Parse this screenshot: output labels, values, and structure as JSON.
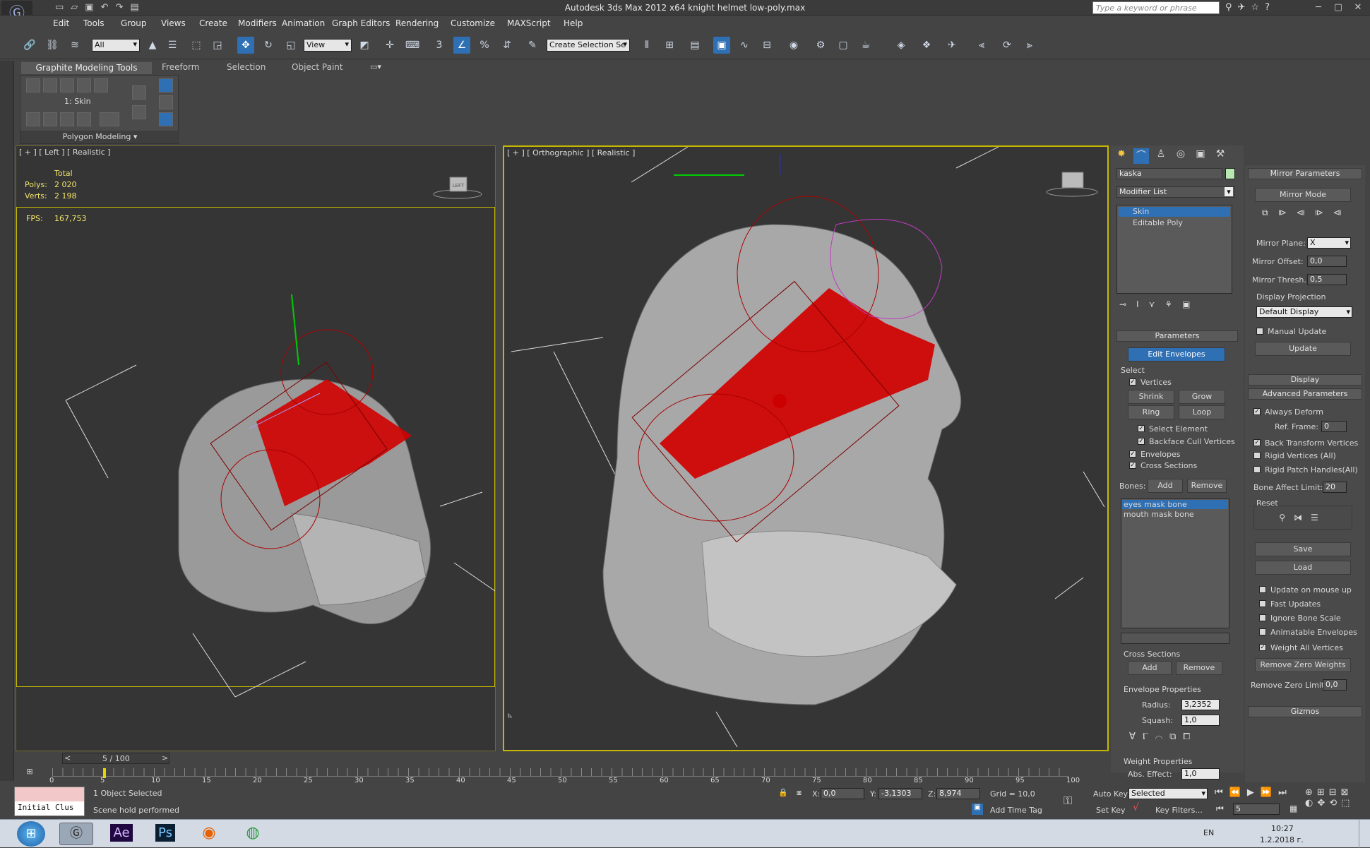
{
  "titlebar": {
    "title": "Autodesk 3ds Max  2012 x64     knight helmet low-poly.max",
    "search_placeholder": "Type a keyword or phrase"
  },
  "menu": [
    "Edit",
    "Tools",
    "Group",
    "Views",
    "Create",
    "Modifiers",
    "Animation",
    "Graph Editors",
    "Rendering",
    "Customize",
    "MAXScript",
    "Help"
  ],
  "toolbar": {
    "selection_filter": "All",
    "ref_coord": "View",
    "snap_label": "3",
    "named_selection": "Create Selection Se"
  },
  "ribbon": {
    "tabs": [
      "Graphite Modeling Tools",
      "Freeform",
      "Selection",
      "Object Paint"
    ],
    "skin_label": "1: Skin",
    "section": "Polygon Modeling"
  },
  "viewport_left": {
    "label": "[ + ] [ Left ] [ Realistic ]",
    "total": "Total",
    "polys_label": "Polys:",
    "polys": "2 020",
    "verts_label": "Verts:",
    "verts": "2 198",
    "fps_label": "FPS:",
    "fps": "167,753",
    "viewcube": "LEFT"
  },
  "viewport_right": {
    "label": "[ + ] [ Orthographic ] [ Realistic ]"
  },
  "command_panel": {
    "object_name": "kaska",
    "modifier_list": "Modifier List",
    "stack": [
      "Skin",
      "Editable Poly"
    ],
    "parameters_header": "Parameters",
    "edit_envelopes": "Edit Envelopes",
    "select_label": "Select",
    "vertices": "Vertices",
    "shrink": "Shrink",
    "grow": "Grow",
    "ring": "Ring",
    "loop": "Loop",
    "select_element": "Select Element",
    "backface": "Backface Cull Vertices",
    "envelopes": "Envelopes",
    "cross_sections": "Cross Sections",
    "bones_label": "Bones:",
    "add": "Add",
    "remove": "Remove",
    "bones": [
      "eyes  mask bone",
      "mouth mask bone"
    ],
    "cross_sections_label": "Cross Sections",
    "cs_add": "Add",
    "cs_remove": "Remove",
    "envelope_props": "Envelope Properties",
    "radius_label": "Radius:",
    "radius": "3,2352",
    "squash_label": "Squash:",
    "squash": "1,0",
    "weight_props": "Weight Properties",
    "abs_effect_label": "Abs. Effect:",
    "abs_effect": "1,0"
  },
  "rollout": {
    "mirror_params": "Mirror Parameters",
    "mirror_mode": "Mirror Mode",
    "mirror_plane_label": "Mirror Plane:",
    "mirror_plane": "X",
    "mirror_offset_label": "Mirror Offset:",
    "mirror_offset": "0,0",
    "mirror_thresh_label": "Mirror Thresh.:",
    "mirror_thresh": "0,5",
    "display_projection": "Display Projection",
    "default_display": "Default Display",
    "manual_update": "Manual Update",
    "update": "Update",
    "display": "Display",
    "advanced": "Advanced Parameters",
    "always_deform": "Always Deform",
    "ref_frame_label": "Ref. Frame:",
    "ref_frame": "0",
    "back_transform": "Back Transform Vertices",
    "rigid_vertices": "Rigid Vertices (All)",
    "rigid_patch": "Rigid Patch Handles(All)",
    "bone_affect_label": "Bone Affect Limit:",
    "bone_affect": "20",
    "reset": "Reset",
    "save": "Save",
    "load": "Load",
    "update_mouse": "Update on mouse up",
    "fast_updates": "Fast Updates",
    "ignore_bone_scale": "Ignore Bone Scale",
    "animatable_env": "Animatable Envelopes",
    "weight_all": "Weight All Vertices",
    "remove_zero": "Remove Zero Weights",
    "remove_zero_limit_label": "Remove Zero Limit:",
    "remove_zero_limit": "0,0",
    "gizmos": "Gizmos"
  },
  "timeline": {
    "frame": "5 / 100",
    "ticks": [
      "0",
      "5",
      "10",
      "15",
      "20",
      "25",
      "30",
      "35",
      "40",
      "45",
      "50",
      "55",
      "60",
      "65",
      "70",
      "75",
      "80",
      "85",
      "90",
      "95",
      "100"
    ]
  },
  "status": {
    "objects": "1 Object Selected",
    "prompt": "Scene hold performed",
    "x_label": "X:",
    "x": "0,0",
    "y_label": "Y:",
    "y": "-3,1303",
    "z_label": "Z:",
    "z": "8,974",
    "grid": "Grid = 10,0",
    "add_time_tag": "Add Time Tag",
    "auto_key": "Auto Key",
    "selected": "Selected",
    "set_key": "Set Key",
    "key_filters": "Key Filters...",
    "frame": "5",
    "maxscript": "Initial Clus"
  },
  "taskbar": {
    "lang": "EN",
    "time": "10:27",
    "date": "1.2.2018 г.",
    "apps": [
      "Ae",
      "Ps"
    ]
  }
}
